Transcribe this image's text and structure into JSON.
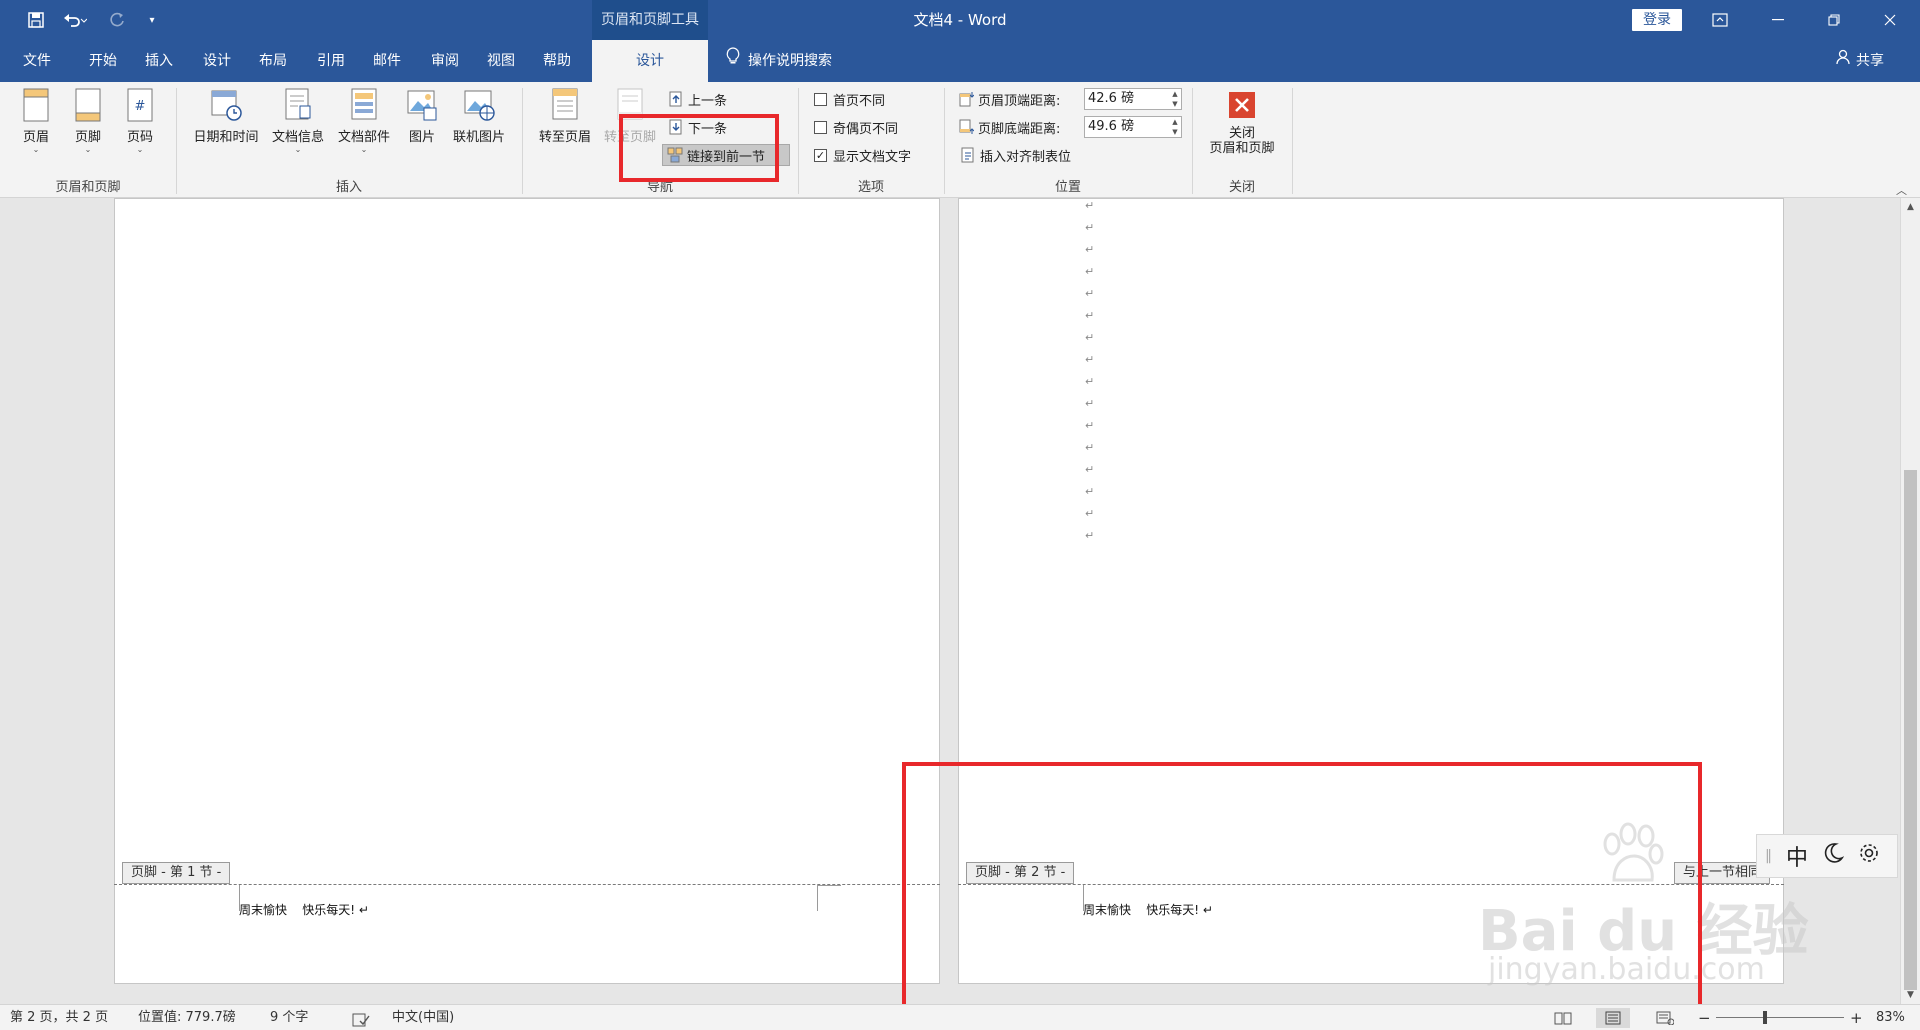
{
  "titlebar": {
    "context_tool": "页眉和页脚工具",
    "doc_title": "文档4  -  Word",
    "login": "登录"
  },
  "tabs": [
    {
      "label": "文件"
    },
    {
      "label": "开始"
    },
    {
      "label": "插入"
    },
    {
      "label": "设计"
    },
    {
      "label": "布局"
    },
    {
      "label": "引用"
    },
    {
      "label": "邮件"
    },
    {
      "label": "审阅"
    },
    {
      "label": "视图"
    },
    {
      "label": "帮助"
    },
    {
      "label": "设计"
    }
  ],
  "tell_me": "操作说明搜索",
  "share": "共享",
  "ribbon": {
    "hf_group": {
      "label": "页眉和页脚",
      "header": "页眉",
      "footer": "页脚",
      "page_number": "页码"
    },
    "insert_group": {
      "label": "插入",
      "datetime": "日期和时间",
      "docinfo": "文档信息",
      "quickparts": "文档部件",
      "picture": "图片",
      "online_picture": "联机图片"
    },
    "nav_group": {
      "label": "导航",
      "goto_header": "转至页眉",
      "goto_footer": "转至页脚",
      "previous": "上一条",
      "next": "下一条",
      "link_previous": "链接到前一节"
    },
    "options_group": {
      "label": "选项",
      "different_first": "首页不同",
      "different_odd_even": "奇偶页不同",
      "show_doc_text": "显示文档文字",
      "show_doc_text_checked": true
    },
    "position_group": {
      "label": "位置",
      "header_top_label": "页眉顶端距离:",
      "header_top_value": "42.6 磅",
      "footer_bottom_label": "页脚底端距离:",
      "footer_bottom_value": "49.6 磅",
      "insert_align_tab": "插入对齐制表位"
    },
    "close_group": {
      "label": "关闭",
      "close_line1": "关闭",
      "close_line2": "页眉和页脚"
    }
  },
  "document": {
    "para_mark": "↵",
    "page1": {
      "footer_tag": "页脚 - 第 1 节 -",
      "footer_text": "周末愉快    快乐每天! ↵"
    },
    "page2": {
      "footer_tag": "页脚 - 第 2 节 -",
      "footer_text": "周末愉快    快乐每天! ↵",
      "same_as_previous": "与上一节相同"
    }
  },
  "ime": {
    "mode": "中"
  },
  "statusbar": {
    "page": "第 2 页，共 2 页",
    "position": "位置值: 779.7磅",
    "words": "9 个字",
    "language": "中文(中国)",
    "zoom": "83%"
  },
  "watermark": {
    "brand": "Bai du 经验",
    "url": "jingyan.baidu.com"
  },
  "colors": {
    "accent": "#2b579a",
    "annotation": "#e8282b"
  }
}
